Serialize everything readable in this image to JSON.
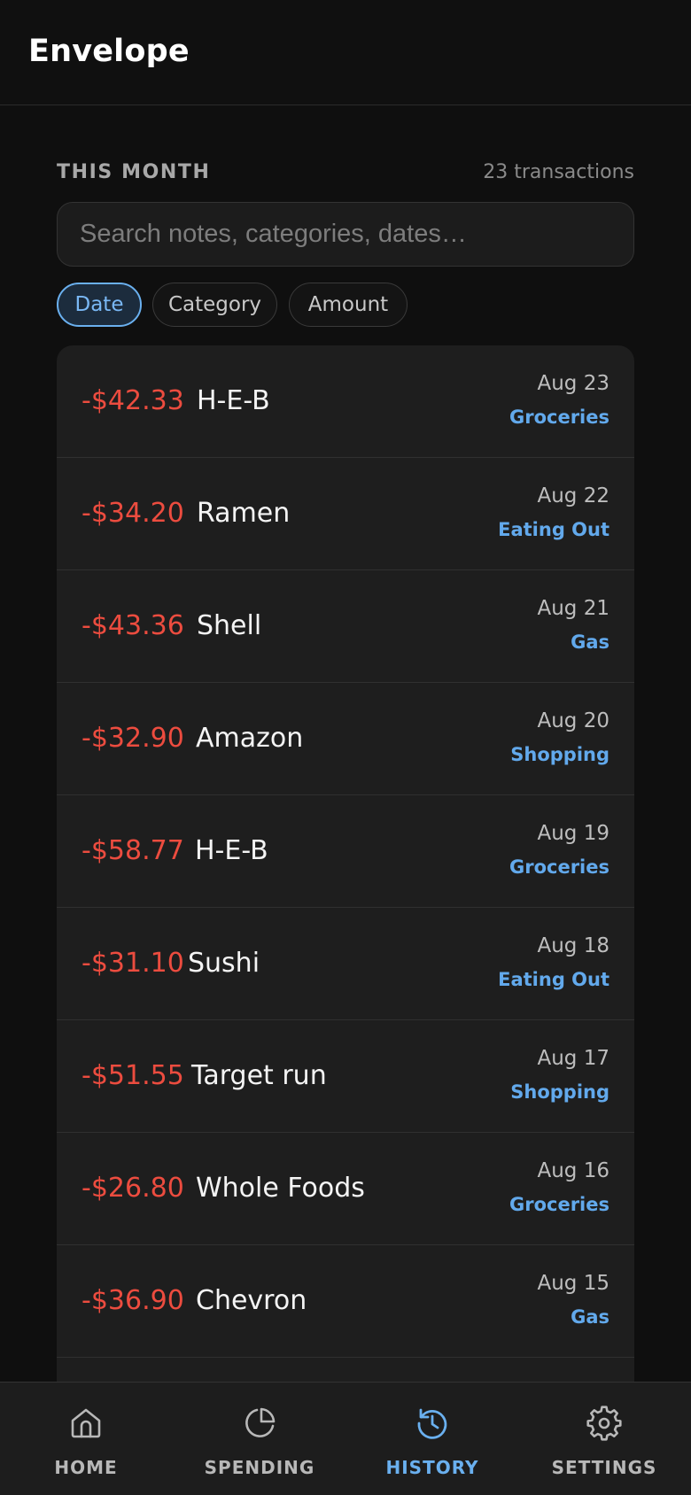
{
  "header": {
    "title": "Envelope"
  },
  "section": {
    "label": "THIS MONTH",
    "count": "23 transactions"
  },
  "search": {
    "placeholder": "Search notes, categories, dates…",
    "value": ""
  },
  "sort_chips": [
    {
      "label": "Date",
      "active": true
    },
    {
      "label": "Category",
      "active": false
    },
    {
      "label": "Amount",
      "active": false
    }
  ],
  "transactions": [
    {
      "amount": "-$42.33",
      "merchant": "H-E-B",
      "date": "Aug 23",
      "category": "Groceries"
    },
    {
      "amount": "-$34.20",
      "merchant": "Ramen",
      "date": "Aug 22",
      "category": "Eating Out"
    },
    {
      "amount": "-$43.36",
      "merchant": "Shell",
      "date": "Aug 21",
      "category": "Gas"
    },
    {
      "amount": "-$32.90",
      "merchant": "Amazon",
      "date": "Aug 20",
      "category": "Shopping"
    },
    {
      "amount": "-$58.77",
      "merchant": "H-E-B",
      "date": "Aug 19",
      "category": "Groceries"
    },
    {
      "amount": "-$31.10",
      "merchant": "Sushi",
      "date": "Aug 18",
      "category": "Eating Out"
    },
    {
      "amount": "-$51.55",
      "merchant": "Target run",
      "date": "Aug 17",
      "category": "Shopping"
    },
    {
      "amount": "-$26.80",
      "merchant": "Whole Foods",
      "date": "Aug 16",
      "category": "Groceries"
    },
    {
      "amount": "-$36.90",
      "merchant": "Chevron",
      "date": "Aug 15",
      "category": "Gas"
    }
  ],
  "bottom_nav": [
    {
      "label": "HOME",
      "icon": "home-icon",
      "active": false
    },
    {
      "label": "SPENDING",
      "icon": "pie-chart-icon",
      "active": false
    },
    {
      "label": "HISTORY",
      "icon": "history-icon",
      "active": true
    },
    {
      "label": "SETTINGS",
      "icon": "gear-icon",
      "active": false
    }
  ],
  "colors": {
    "background": "#0f0f0f",
    "card": "#1e1e1e",
    "amount_negative": "#ec4c3f",
    "accent": "#6ab0ef"
  }
}
